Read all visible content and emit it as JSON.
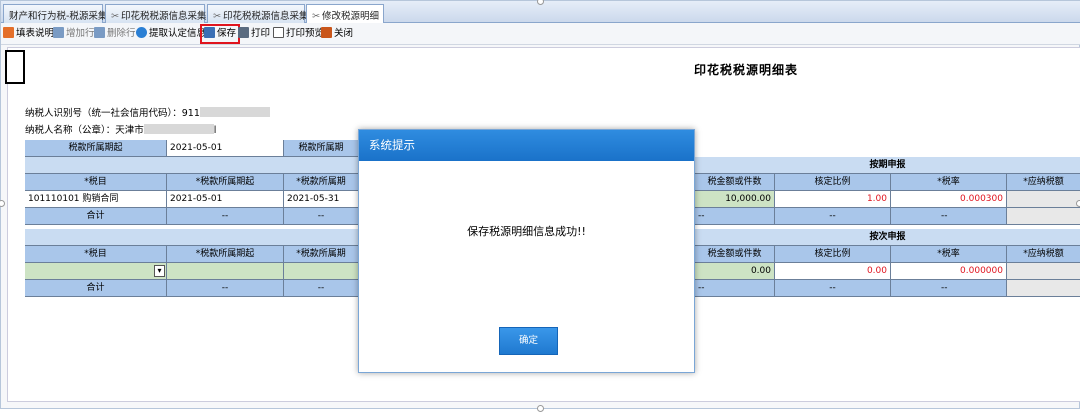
{
  "tabs": [
    {
      "label": "财产和行为税-税源采集",
      "active": false
    },
    {
      "label": "印花税税源信息采集",
      "active": false
    },
    {
      "label": "印花税税源信息采集",
      "active": false
    },
    {
      "label": "修改税源明细",
      "active": true
    }
  ],
  "toolbar": {
    "fill_help": "填表说明",
    "add_row": "增加行",
    "delete_row": "删除行",
    "fetch_info": "提取认定信息",
    "save": "保存",
    "print": "打印",
    "print_preview": "打印预览",
    "close": "关闭"
  },
  "page": {
    "title": "印花税税源明细表",
    "taxpayer_id_label": "纳税人识别号（统一社会信用代码）：911",
    "taxpayer_name_label": "纳税人名称（公章）：天津市",
    "taxpayer_name_tail": "l"
  },
  "table": {
    "period_start_label": "税款所属期起",
    "period_start_value": "2021-05-01",
    "period_end_label": "税款所属期",
    "sec1_title": "按期申报",
    "sec2_title": "按次申报",
    "col_item": "*税目",
    "col_start": "*税款所属期起",
    "col_end": "*税款所属期",
    "col_amount": "税金额或件数",
    "col_ratio": "核定比例",
    "col_rate": "*税率",
    "col_payable": "*应纳税额",
    "row1": {
      "item": "101110101 购销合同",
      "start": "2021-05-01",
      "end": "2021-05-31",
      "amount": "10,000.00",
      "ratio": "1.00",
      "rate": "0.000300"
    },
    "row2": {
      "amount": "0.00",
      "ratio": "0.00",
      "rate": "0.000000"
    },
    "subtotal": "合计",
    "dash": "--",
    "dropdown_arrow": "▾"
  },
  "dialog": {
    "title": "系统提示",
    "message": "保存税源明细信息成功!!",
    "ok": "确定"
  },
  "colors": {
    "highlight": "#e0141e",
    "dialog_header": "#1f79cf",
    "header_cell": "#a9c6ea"
  }
}
